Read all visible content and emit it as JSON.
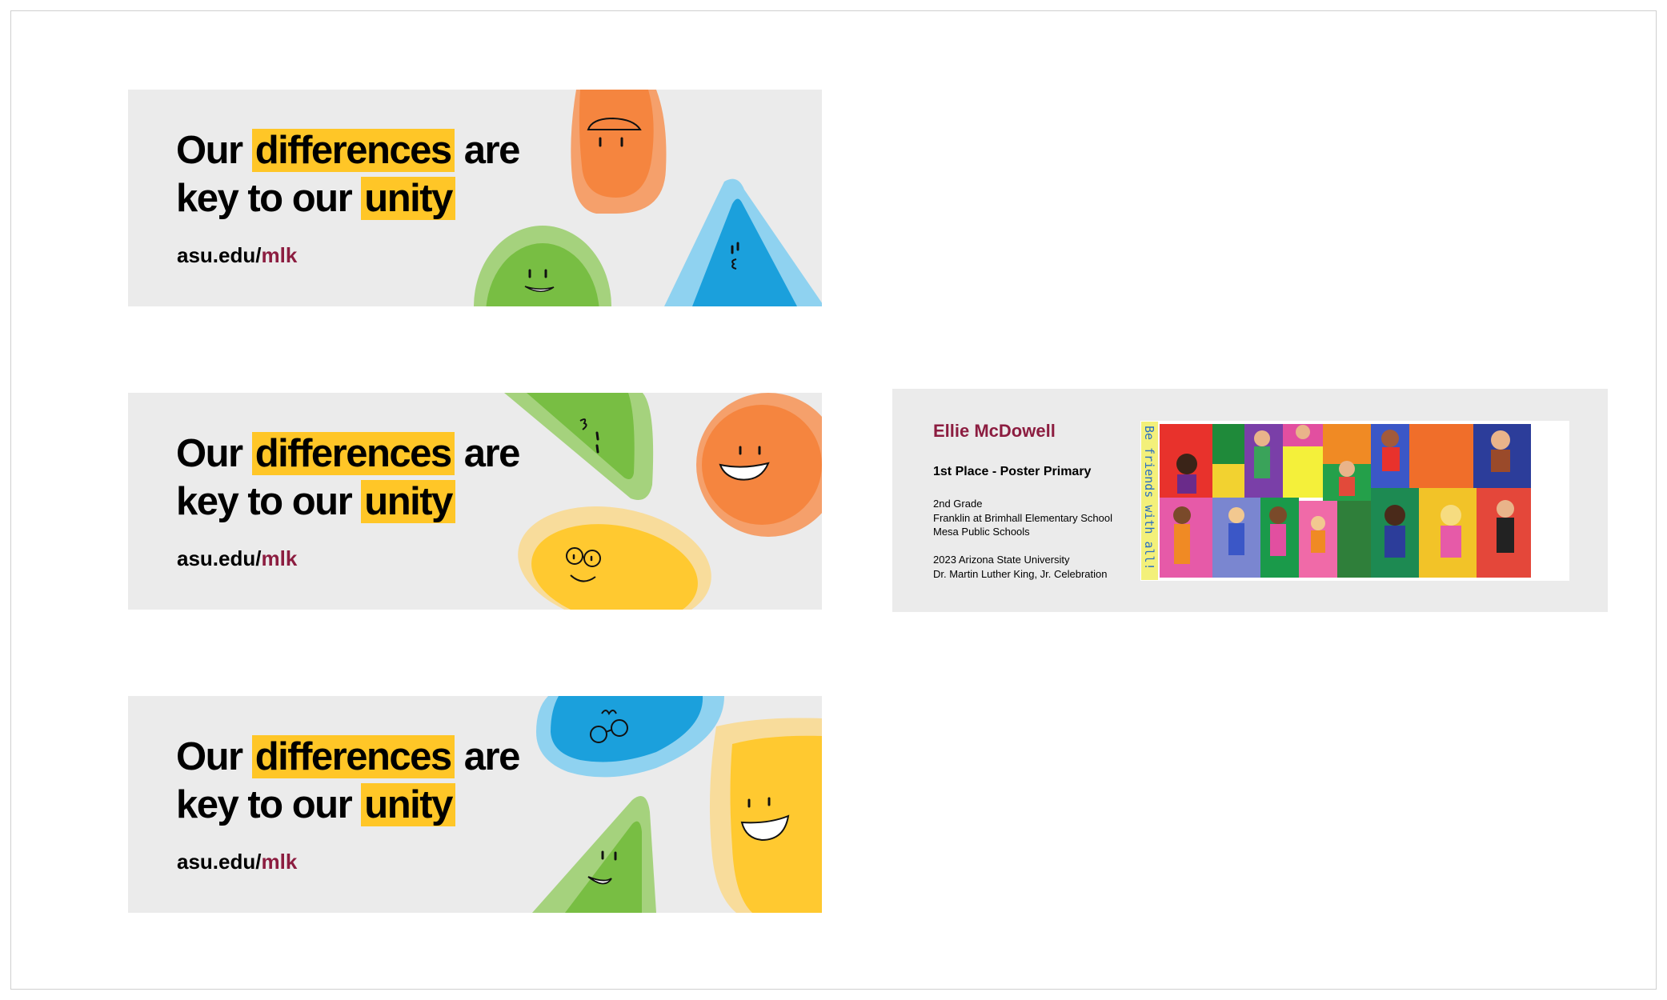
{
  "banners": [
    {
      "line1_start": "Our ",
      "line1_highlight": "differences",
      "line1_end": " are",
      "line2_start": "key to our ",
      "line2_highlight": "unity",
      "url_prefix": "asu.edu/",
      "url_accent": "mlk"
    },
    {
      "line1_start": "Our ",
      "line1_highlight": "differences",
      "line1_end": " are",
      "line2_start": "key to our ",
      "line2_highlight": "unity",
      "url_prefix": "asu.edu/",
      "url_accent": "mlk"
    },
    {
      "line1_start": "Our ",
      "line1_highlight": "differences",
      "line1_end": " are",
      "line2_start": "key to our ",
      "line2_highlight": "unity",
      "url_prefix": "asu.edu/",
      "url_accent": "mlk"
    }
  ],
  "award": {
    "name": "Ellie McDowell",
    "place": "1st Place - Poster Primary",
    "grade": "2nd Grade",
    "school": "Franklin at Brimhall Elementary School",
    "district": "Mesa Public Schools",
    "event_line1": "2023 Arizona State University",
    "event_line2": "Dr. Martin Luther King, Jr. Celebration",
    "poster_caption": "Be friends with all!"
  },
  "colors": {
    "highlight": "#ffc627",
    "maroon": "#8c1d40",
    "banner_bg": "#ebebeb",
    "orange": "#f5853f",
    "green": "#78be43",
    "blue": "#1ba0dc",
    "yellow": "#ffc930"
  }
}
